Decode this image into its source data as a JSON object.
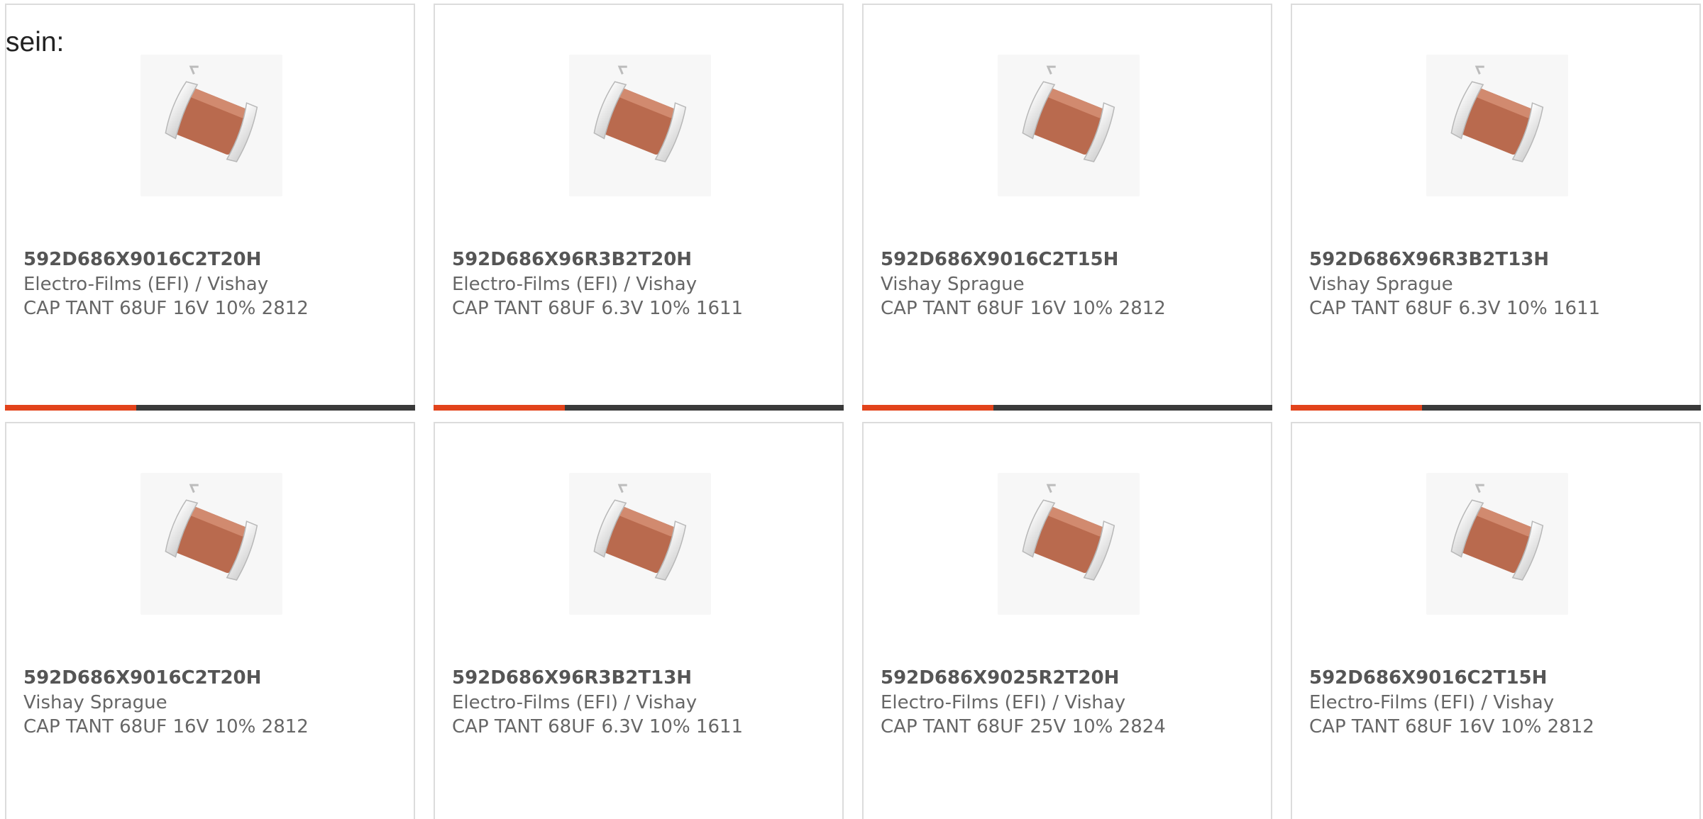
{
  "intro_text": "sein:",
  "colors": {
    "accent": "#e2431b",
    "bar_track": "#3a3a3a",
    "capacitor_body": "#b96a4e",
    "capacitor_terminal": "#e9e9e9"
  },
  "cards": [
    {
      "part_number": "592D686X9016C2T20H",
      "manufacturer": "Electro-Films (EFI) / Vishay",
      "description": "CAP TANT 68UF 16V 10% 2812",
      "image_icon": "smd-capacitor-icon",
      "progress_fraction": 0.32
    },
    {
      "part_number": "592D686X96R3B2T20H",
      "manufacturer": "Electro-Films (EFI) / Vishay",
      "description": "CAP TANT 68UF 6.3V 10% 1611",
      "image_icon": "smd-capacitor-icon",
      "progress_fraction": 0.32
    },
    {
      "part_number": "592D686X9016C2T15H",
      "manufacturer": "Vishay Sprague",
      "description": "CAP TANT 68UF 16V 10% 2812",
      "image_icon": "smd-capacitor-icon",
      "progress_fraction": 0.32
    },
    {
      "part_number": "592D686X96R3B2T13H",
      "manufacturer": "Vishay Sprague",
      "description": "CAP TANT 68UF 6.3V 10% 1611",
      "image_icon": "smd-capacitor-icon",
      "progress_fraction": 0.32
    },
    {
      "part_number": "592D686X9016C2T20H",
      "manufacturer": "Vishay Sprague",
      "description": "CAP TANT 68UF 16V 10% 2812",
      "image_icon": "smd-capacitor-icon"
    },
    {
      "part_number": "592D686X96R3B2T13H",
      "manufacturer": "Electro-Films (EFI) / Vishay",
      "description": "CAP TANT 68UF 6.3V 10% 1611",
      "image_icon": "smd-capacitor-icon"
    },
    {
      "part_number": "592D686X9025R2T20H",
      "manufacturer": "Electro-Films (EFI) / Vishay",
      "description": "CAP TANT 68UF 25V 10% 2824",
      "image_icon": "smd-capacitor-icon"
    },
    {
      "part_number": "592D686X9016C2T15H",
      "manufacturer": "Electro-Films (EFI) / Vishay",
      "description": "CAP TANT 68UF 16V 10% 2812",
      "image_icon": "smd-capacitor-icon"
    }
  ]
}
